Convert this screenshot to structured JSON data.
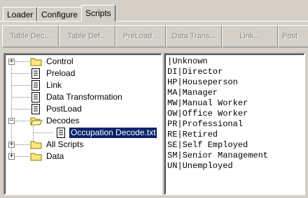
{
  "tabs": [
    {
      "label": "Loader"
    },
    {
      "label": "Configure"
    },
    {
      "label": "Scripts",
      "active": true
    }
  ],
  "toolbar": {
    "buttons": [
      {
        "label": "Table Dec...",
        "enabled": false
      },
      {
        "label": "Table Def...",
        "enabled": false
      },
      {
        "label": "PreLoad...",
        "enabled": false
      },
      {
        "label": "Data Trans...",
        "enabled": false
      },
      {
        "label": "Link...",
        "enabled": false
      },
      {
        "label": "Post",
        "enabled": false
      }
    ]
  },
  "tree": {
    "items": [
      {
        "label": "Control",
        "type": "folder",
        "expander": "+"
      },
      {
        "label": "Preload",
        "type": "document"
      },
      {
        "label": "Link",
        "type": "document"
      },
      {
        "label": "Data Transformation",
        "type": "document"
      },
      {
        "label": "PostLoad",
        "type": "document"
      },
      {
        "label": "Decodes",
        "type": "folder-open",
        "expander": "−"
      },
      {
        "label": "Occupation Decode.txt",
        "type": "document",
        "selected": true
      },
      {
        "label": "All Scripts",
        "type": "folder",
        "expander": "+"
      },
      {
        "label": "Data",
        "type": "folder",
        "expander": "+"
      }
    ]
  },
  "editor": {
    "lines": [
      "|Unknown",
      "DI|Director",
      "HP|Houseperson",
      "MA|Manager",
      "MW|Manual Worker",
      "OW|Office Worker",
      "PR|Professional",
      "RE|Retired",
      "SE|Self Employed",
      "SM|Senior Management",
      "UN|Unemployed"
    ]
  },
  "colors": {
    "selection": "#0a246a",
    "folder": "#ffe680",
    "window": "#d4d0c8"
  }
}
